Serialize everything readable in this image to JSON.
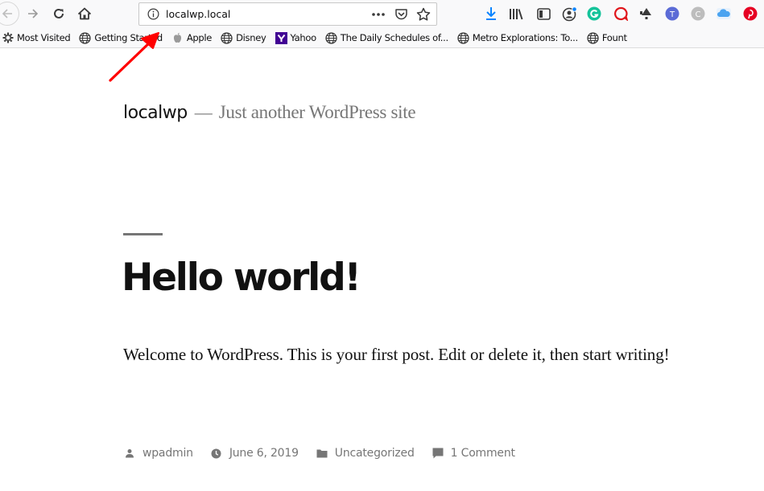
{
  "browser": {
    "nav": {
      "back_icon": "arrow-left-icon",
      "forward_icon": "arrow-right-icon",
      "reload_icon": "reload-icon",
      "home_icon": "home-icon"
    },
    "urlbar": {
      "value": "localwp.local",
      "site_info_icon": "info-circle-icon",
      "page_actions_icon": "ellipsis-icon",
      "pocket_icon": "pocket-icon",
      "bookmark_icon": "star-icon"
    },
    "toolbar_icons": [
      {
        "name": "downloads",
        "icon": "download-arrow-icon",
        "color": "#0a84ff"
      },
      {
        "name": "library",
        "icon": "library-icon",
        "color": "#3a3a3a"
      },
      {
        "name": "sidebar",
        "icon": "sidebar-icon",
        "color": "#3a3a3a"
      },
      {
        "name": "account",
        "icon": "account-icon",
        "color": "#3a3a3a"
      },
      {
        "name": "grammarly",
        "icon": "grammarly-icon",
        "color": "#15c39a"
      },
      {
        "name": "extension-red",
        "icon": "speech-bubble-icon",
        "color": "#e0151b"
      },
      {
        "name": "extension-dark",
        "icon": "bell-icon",
        "color": "#3a3a3a"
      },
      {
        "name": "extension-t",
        "icon": "circle-t-icon",
        "color": "#5b6bd6"
      },
      {
        "name": "extension-c",
        "icon": "circle-c-icon",
        "color": "#bdbdbd"
      },
      {
        "name": "cloud",
        "icon": "cloud-icon",
        "color": "#4aa3f0"
      },
      {
        "name": "pinterest",
        "icon": "pinterest-icon",
        "color": "#e60023"
      }
    ],
    "bookmarks": [
      {
        "label": "Most Visited",
        "icon": "gear-icon"
      },
      {
        "label": "Getting Started",
        "icon": "globe-icon"
      },
      {
        "label": "Apple",
        "icon": "apple-icon"
      },
      {
        "label": "Disney",
        "icon": "globe-icon"
      },
      {
        "label": "Yahoo",
        "icon": "yahoo-icon"
      },
      {
        "label": "The Daily Schedules of...",
        "icon": "globe-icon"
      },
      {
        "label": "Metro Explorations: To...",
        "icon": "globe-icon"
      },
      {
        "label": "Fount",
        "icon": "globe-icon"
      }
    ]
  },
  "site": {
    "title": "localwp",
    "separator": "—",
    "description": "Just another WordPress site"
  },
  "post": {
    "title": "Hello world!",
    "content": "Welcome to WordPress. This is your first post. Edit or delete it, then start writing!",
    "meta": {
      "author": "wpadmin",
      "date": "June 6, 2019",
      "category": "Uncategorized",
      "comments": "1 Comment"
    }
  },
  "annotation": {
    "type": "arrow",
    "color": "#ff0000",
    "points_to": "urlbar"
  },
  "colors": {
    "text_primary": "#111111",
    "text_secondary": "#767676",
    "chrome_bg": "#f9f9fa"
  }
}
